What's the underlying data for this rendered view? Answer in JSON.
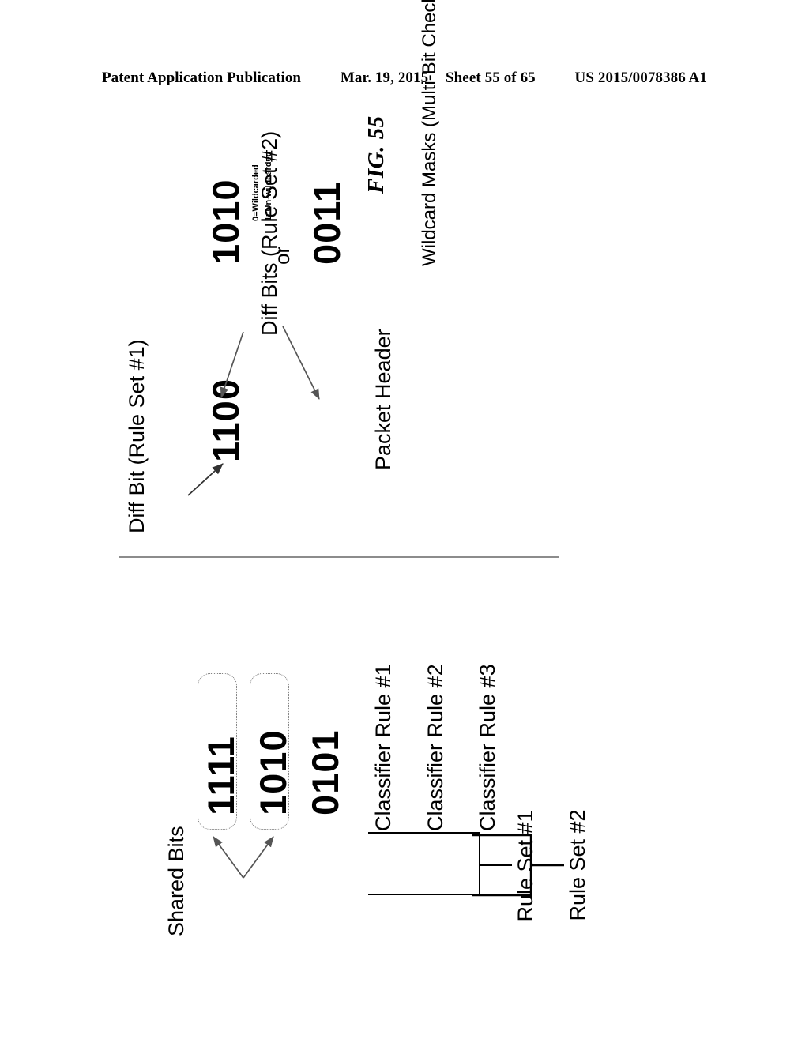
{
  "patent_header": {
    "publication": "Patent Application Publication",
    "date": "Mar. 19, 2015",
    "sheet": "Sheet 55 of 65",
    "number": "US 2015/0078386 A1"
  },
  "figure": {
    "label": "FIG. 55",
    "shared_bits_label": "Shared Bits",
    "rules": [
      {
        "name": "Classifier Rule #1",
        "bits": "1111"
      },
      {
        "name": "Classifier Rule #2",
        "bits": "1010"
      },
      {
        "name": "Classifier Rule #3",
        "bits": "0101"
      }
    ],
    "rule_sets": [
      {
        "label": "Rule Set #1"
      },
      {
        "label": "Rule Set #2"
      }
    ],
    "packet_header": {
      "label": "Packet Header",
      "bits": "1100"
    },
    "diff_bit_rule_set_1_label": "Diff Bit (Rule Set #1)",
    "diff_bits_rule_set_2_label": "Diff Bits (Rule Set #2)",
    "wildcard_masks": {
      "label": "Wildcard Masks (Multi-Bit Check)",
      "mask_a": "1010",
      "or": "or",
      "mask_b": "0011",
      "legend_line_1": "0=Wildcarded",
      "legend_line_2": "1=Un-wildcarded"
    }
  }
}
